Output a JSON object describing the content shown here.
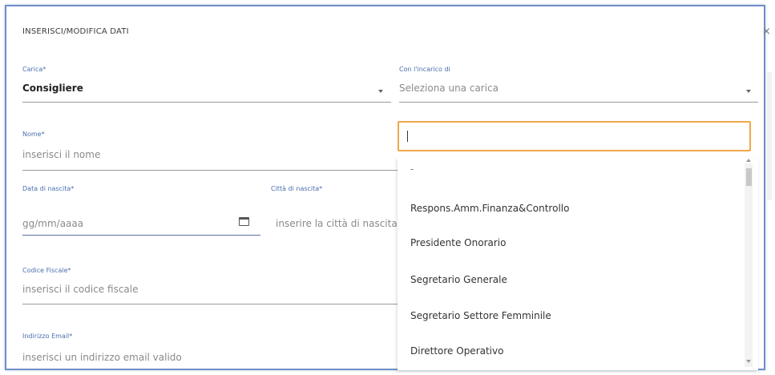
{
  "modal": {
    "title": "INSERISCI/MODIFICA DATI",
    "close": "×"
  },
  "form": {
    "carica": {
      "label": "Carica*",
      "value": "Consigliere"
    },
    "incarico": {
      "label": "Con l'incarico di",
      "placeholder": "Seleziona una carica"
    },
    "nome": {
      "label": "Nome*",
      "placeholder": "inserisci il nome"
    },
    "data_nascita": {
      "label": "Data di nascita*",
      "placeholder": "gg/mm/aaaa"
    },
    "citta_nascita": {
      "label": "Città di nascita*",
      "placeholder": "inserire la città di nascita"
    },
    "codice_fiscale": {
      "label": "Codice Fiscale*",
      "placeholder": "inserisci il codice fiscale"
    },
    "email": {
      "label": "Indirizzo Email*",
      "placeholder": "inserisci un indirizzo email valido"
    }
  },
  "dropdown": {
    "search_value": "",
    "options": [
      "-",
      "Respons.Amm.Finanza&Controllo",
      "Presidente Onorario",
      "Segretario Generale",
      "Segretario Settore Femminile",
      "Direttore Operativo"
    ]
  },
  "icons": {
    "close": "close-icon",
    "calendar": "calendar-icon",
    "caret": "chevron-down-icon"
  },
  "colors": {
    "accent_border": "#6f8fc7",
    "focus_border": "#f0a84a",
    "label": "#4a6fae"
  }
}
